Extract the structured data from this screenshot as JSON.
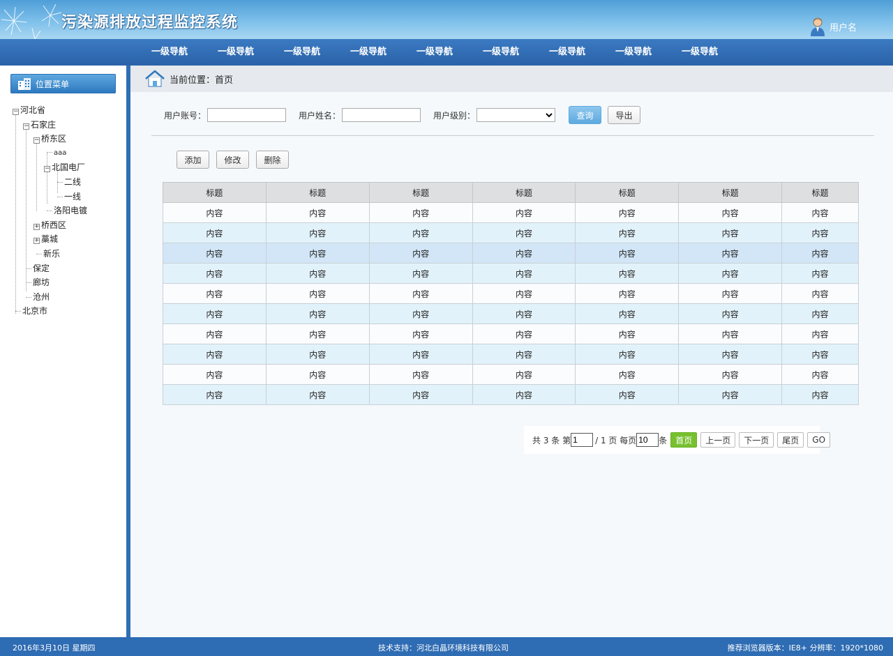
{
  "header": {
    "title": "污染源排放过程监控系统",
    "username": "用户名"
  },
  "nav": {
    "items": [
      "一级导航",
      "一级导航",
      "一级导航",
      "一级导航",
      "一级导航",
      "一级导航",
      "一级导航",
      "一级导航",
      "一级导航"
    ]
  },
  "sidebar": {
    "menu_label": "位置菜单",
    "tree": [
      {
        "label": "河北省",
        "level": 0,
        "expander": "⊟"
      },
      {
        "label": "石家庄",
        "level": 1,
        "expander": "⊟"
      },
      {
        "label": "桥东区",
        "level": 2,
        "expander": "⊟"
      },
      {
        "label": "aaa",
        "level": 3,
        "expander": ""
      },
      {
        "label": "北国电厂",
        "level": 3,
        "expander": "⊟"
      },
      {
        "label": "二线",
        "level": 4,
        "expander": ""
      },
      {
        "label": "一线",
        "level": 4,
        "expander": ""
      },
      {
        "label": "洛阳电镀",
        "level": 3,
        "expander": ""
      },
      {
        "label": "桥西区",
        "level": 2,
        "expander": "⊞"
      },
      {
        "label": "藁城",
        "level": 2,
        "expander": "⊞"
      },
      {
        "label": "新乐",
        "level": 2,
        "expander": ""
      },
      {
        "label": "保定",
        "level": 1,
        "expander": ""
      },
      {
        "label": "廊坊",
        "level": 1,
        "expander": ""
      },
      {
        "label": "沧州",
        "level": 1,
        "expander": ""
      },
      {
        "label": "北京市",
        "level": 0,
        "expander": ""
      }
    ]
  },
  "breadcrumb": {
    "text": "当前位置：首页"
  },
  "search": {
    "account_label": "用户账号：",
    "name_label": "用户姓名：",
    "level_label": "用户级别：",
    "account_value": "",
    "name_value": "",
    "level_value": "",
    "query_button": "查询",
    "export_button": "导出"
  },
  "actions": {
    "add": "添加",
    "edit": "修改",
    "delete": "删除"
  },
  "table": {
    "headers": [
      "标题",
      "标题",
      "标题",
      "标题",
      "标题",
      "标题",
      "标题"
    ],
    "rows": [
      [
        "内容",
        "内容",
        "内容",
        "内容",
        "内容",
        "内容",
        "内容"
      ],
      [
        "内容",
        "内容",
        "内容",
        "内容",
        "内容",
        "内容",
        "内容"
      ],
      [
        "内容",
        "内容",
        "内容",
        "内容",
        "内容",
        "内容",
        "内容"
      ],
      [
        "内容",
        "内容",
        "内容",
        "内容",
        "内容",
        "内容",
        "内容"
      ],
      [
        "内容",
        "内容",
        "内容",
        "内容",
        "内容",
        "内容",
        "内容"
      ],
      [
        "内容",
        "内容",
        "内容",
        "内容",
        "内容",
        "内容",
        "内容"
      ],
      [
        "内容",
        "内容",
        "内容",
        "内容",
        "内容",
        "内容",
        "内容"
      ],
      [
        "内容",
        "内容",
        "内容",
        "内容",
        "内容",
        "内容",
        "内容"
      ],
      [
        "内容",
        "内容",
        "内容",
        "内容",
        "内容",
        "内容",
        "内容"
      ],
      [
        "内容",
        "内容",
        "内容",
        "内容",
        "内容",
        "内容",
        "内容"
      ]
    ],
    "highlighted_row": 2
  },
  "pager": {
    "total_prefix": "共 3 条 第",
    "current_page": "1",
    "page_total": "/ 1 页 每页",
    "page_size": "10",
    "unit": "条",
    "first": "首页",
    "prev": "上一页",
    "next": "下一页",
    "last": "尾页",
    "go": "GO"
  },
  "footer": {
    "date": "2016年3月10日 星期四",
    "support": "技术支持：河北白晶环境科技有限公司",
    "browser": "推荐浏览器版本：IE8+ 分辨率：1920*1080"
  },
  "colors": {
    "nav_bg": "#2a62a8",
    "footer_bg": "#2e6cb3",
    "primary_btn": "#5ea9df",
    "active_page": "#77c130",
    "row_alt": "#e2f2fa"
  }
}
